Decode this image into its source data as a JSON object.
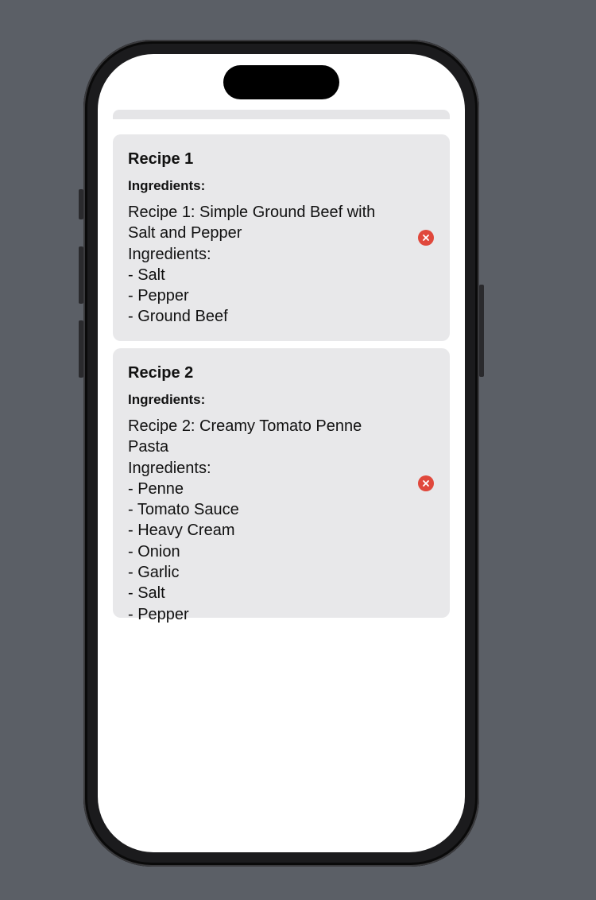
{
  "recipes": [
    {
      "title": "Recipe 1",
      "ingredients_label": "Ingredients:",
      "text": "Recipe 1: Simple Ground Beef with Salt and Pepper\nIngredients:\n- Salt\n- Pepper\n- Ground Beef",
      "delete_icon": "xmark-circle-icon"
    },
    {
      "title": "Recipe 2",
      "ingredients_label": "Ingredients:",
      "text": "Recipe 2: Creamy Tomato Penne Pasta\nIngredients:\n- Penne\n- Tomato Sauce\n- Heavy Cream\n- Onion\n- Garlic\n- Salt\n- Pepper",
      "delete_icon": "xmark-circle-icon"
    }
  ],
  "colors": {
    "background": "#5b5f66",
    "card": "#e8e8ea",
    "delete": "#e0483c"
  }
}
